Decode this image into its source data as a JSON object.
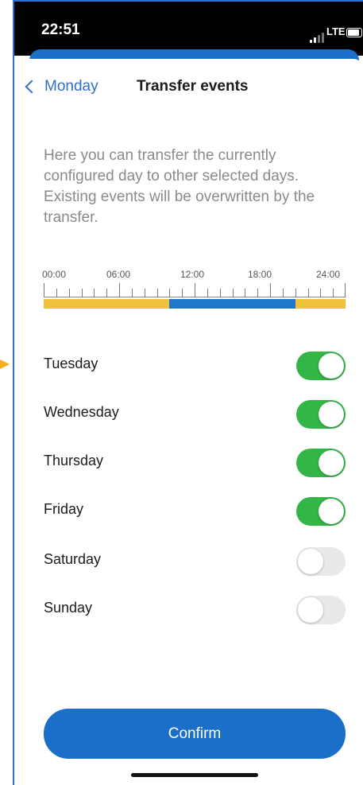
{
  "status_bar": {
    "time": "22:51",
    "network": "LTE"
  },
  "nav": {
    "back_label": "Monday",
    "title": "Transfer events"
  },
  "description": "Here you can transfer the currently configured day to other selected days. Existing events will be overwritten by the transfer.",
  "timeline": {
    "labels": [
      "00:00",
      "06:00",
      "12:00",
      "18:00",
      "24:00"
    ],
    "colors": {
      "yellow": "#f0c13a",
      "blue": "#1f77c9"
    },
    "segments": [
      {
        "from_hour": 0,
        "to_hour": 10,
        "color": "yellow"
      },
      {
        "from_hour": 10,
        "to_hour": 20,
        "color": "blue"
      },
      {
        "from_hour": 20,
        "to_hour": 24,
        "color": "yellow"
      }
    ]
  },
  "days": [
    {
      "label": "Tuesday",
      "enabled": true
    },
    {
      "label": "Wednesday",
      "enabled": true
    },
    {
      "label": "Thursday",
      "enabled": true
    },
    {
      "label": "Friday",
      "enabled": true
    },
    {
      "label": "Saturday",
      "enabled": false
    },
    {
      "label": "Sunday",
      "enabled": false
    }
  ],
  "confirm_label": "Confirm",
  "colors": {
    "accent": "#1c6fc8",
    "toggle_on": "#34b548",
    "toggle_off": "#e9e9ea"
  }
}
